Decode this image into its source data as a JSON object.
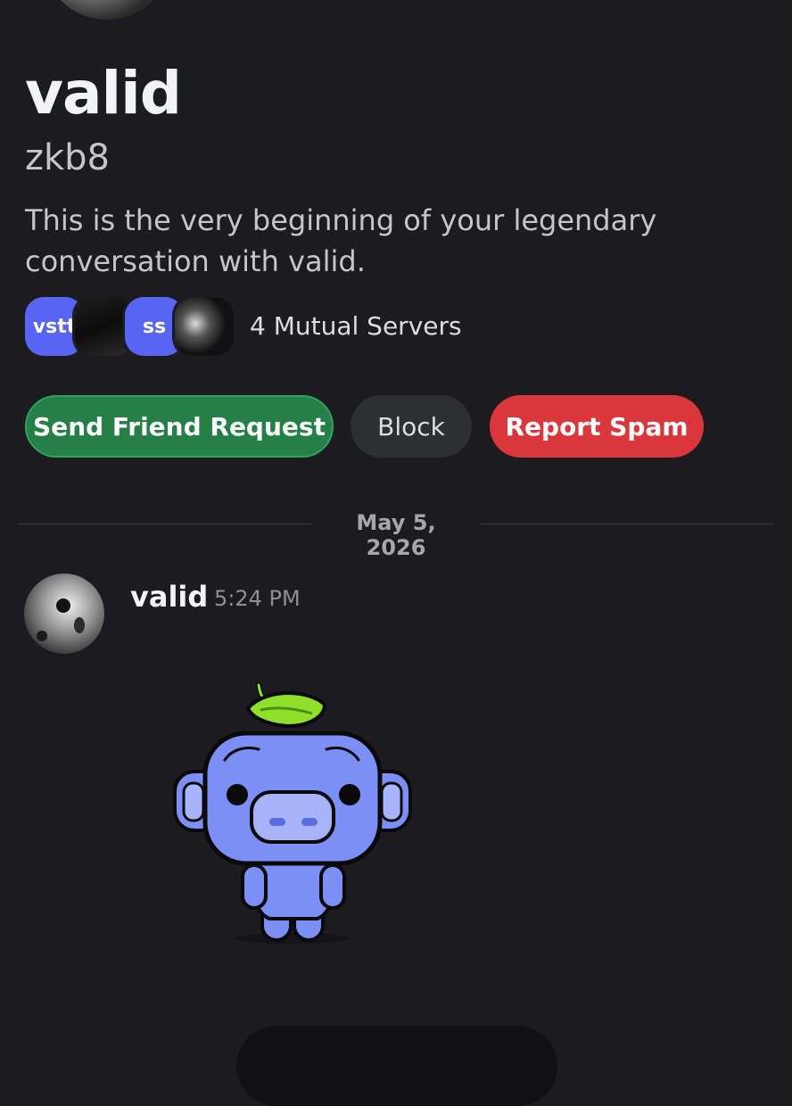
{
  "profile": {
    "display_name": "valid",
    "username": "zkb8",
    "intro": "This is the very beginning of your legendary conversation with valid."
  },
  "mutual_servers": {
    "servers": [
      {
        "label": "vstt",
        "icon": "server-text-icon"
      },
      {
        "label": "",
        "icon": "server-image-icon"
      },
      {
        "label": "ss",
        "icon": "server-text-icon"
      },
      {
        "label": "",
        "icon": "server-image-icon"
      }
    ],
    "label": "4 Mutual Servers"
  },
  "actions": {
    "send_friend_request": "Send Friend Request",
    "block": "Block",
    "report_spam": "Report Spam"
  },
  "date_divider": "May 5, 2026",
  "message": {
    "author": "valid",
    "time": "5:24 PM",
    "sticker": "wumpus-sticker-icon"
  },
  "colors": {
    "background": "#1b1b20",
    "friend_button": "#248046",
    "block_button": "#2e2f35",
    "spam_button": "#da373c",
    "server_blurple": "#5865f2",
    "wumpus": "#7c8ff4"
  }
}
